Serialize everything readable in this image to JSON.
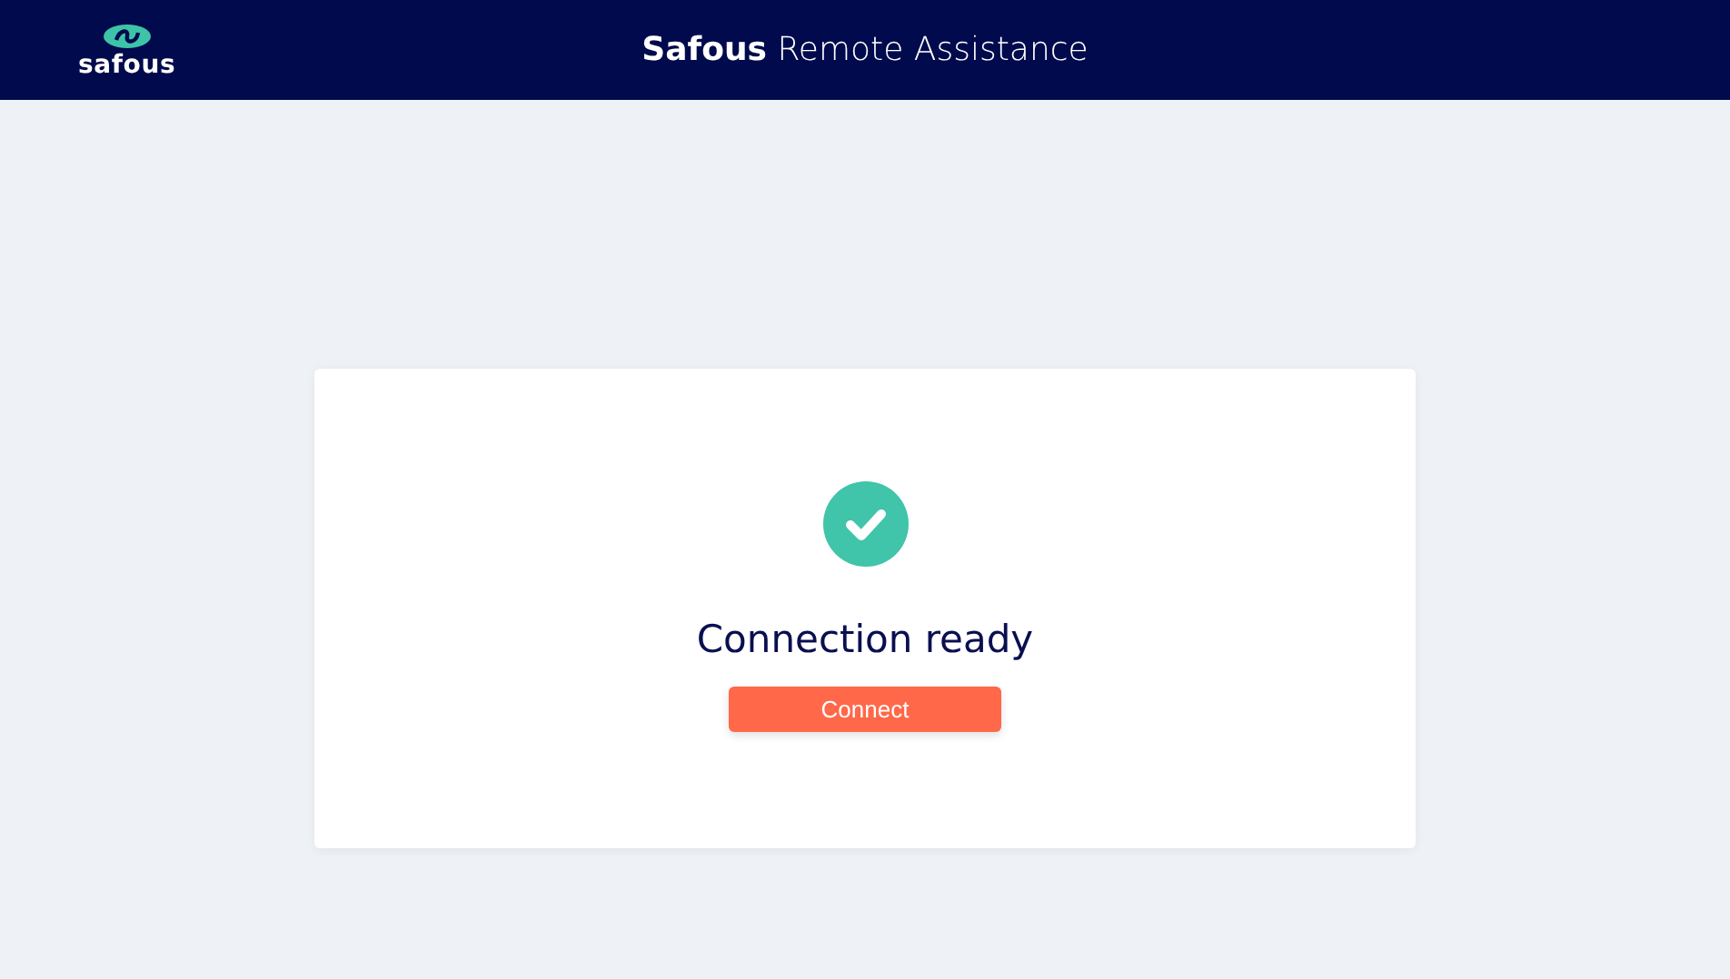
{
  "header": {
    "logo_text": "safous",
    "title": "**Safous** Remote Assistance"
  },
  "card": {
    "status": "Connection ready",
    "button": "Connect"
  }
}
